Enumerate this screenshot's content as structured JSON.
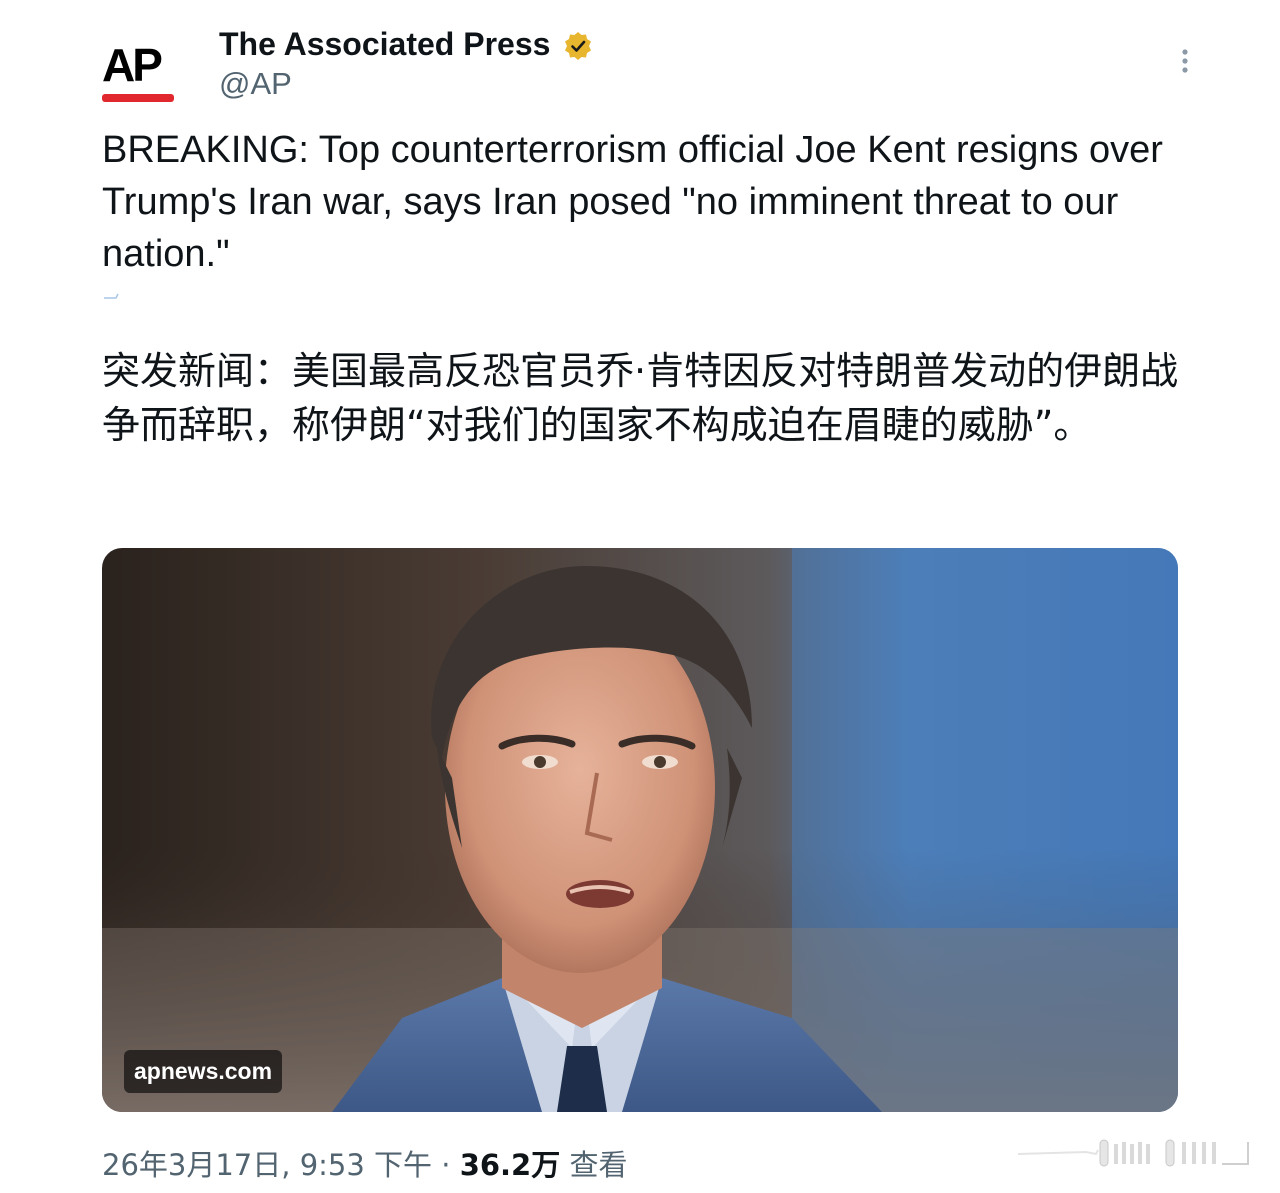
{
  "author": {
    "name": "The Associated Press",
    "handle": "@AP",
    "avatar_text": "AP",
    "avatar_accent": "#e0282e",
    "verified_icon": "gold-verified-badge-icon"
  },
  "tweet": {
    "text_en": "BREAKING: Top counterterrorism official Joe Kent resigns over Trump's Iran war, says Iran posed \"no imminent threat to our nation.\"",
    "text_zh": "突发新闻：美国最高反恐官员乔·肯特因反对特朗普发动的伊朗战争而辞职，称伊朗“对我们的国家不构成迫在眉睫的威胁”。"
  },
  "media": {
    "domain": "apnews.com",
    "image_description_icon": "portrait-photo"
  },
  "meta": {
    "timestamp": "26年3月17日, 9:53 下午",
    "separator": " · ",
    "views_count": "36.2万",
    "views_label": " 查看"
  },
  "icons": {
    "more": "more-vertical-icon",
    "verified_color": "#e8b52e"
  }
}
